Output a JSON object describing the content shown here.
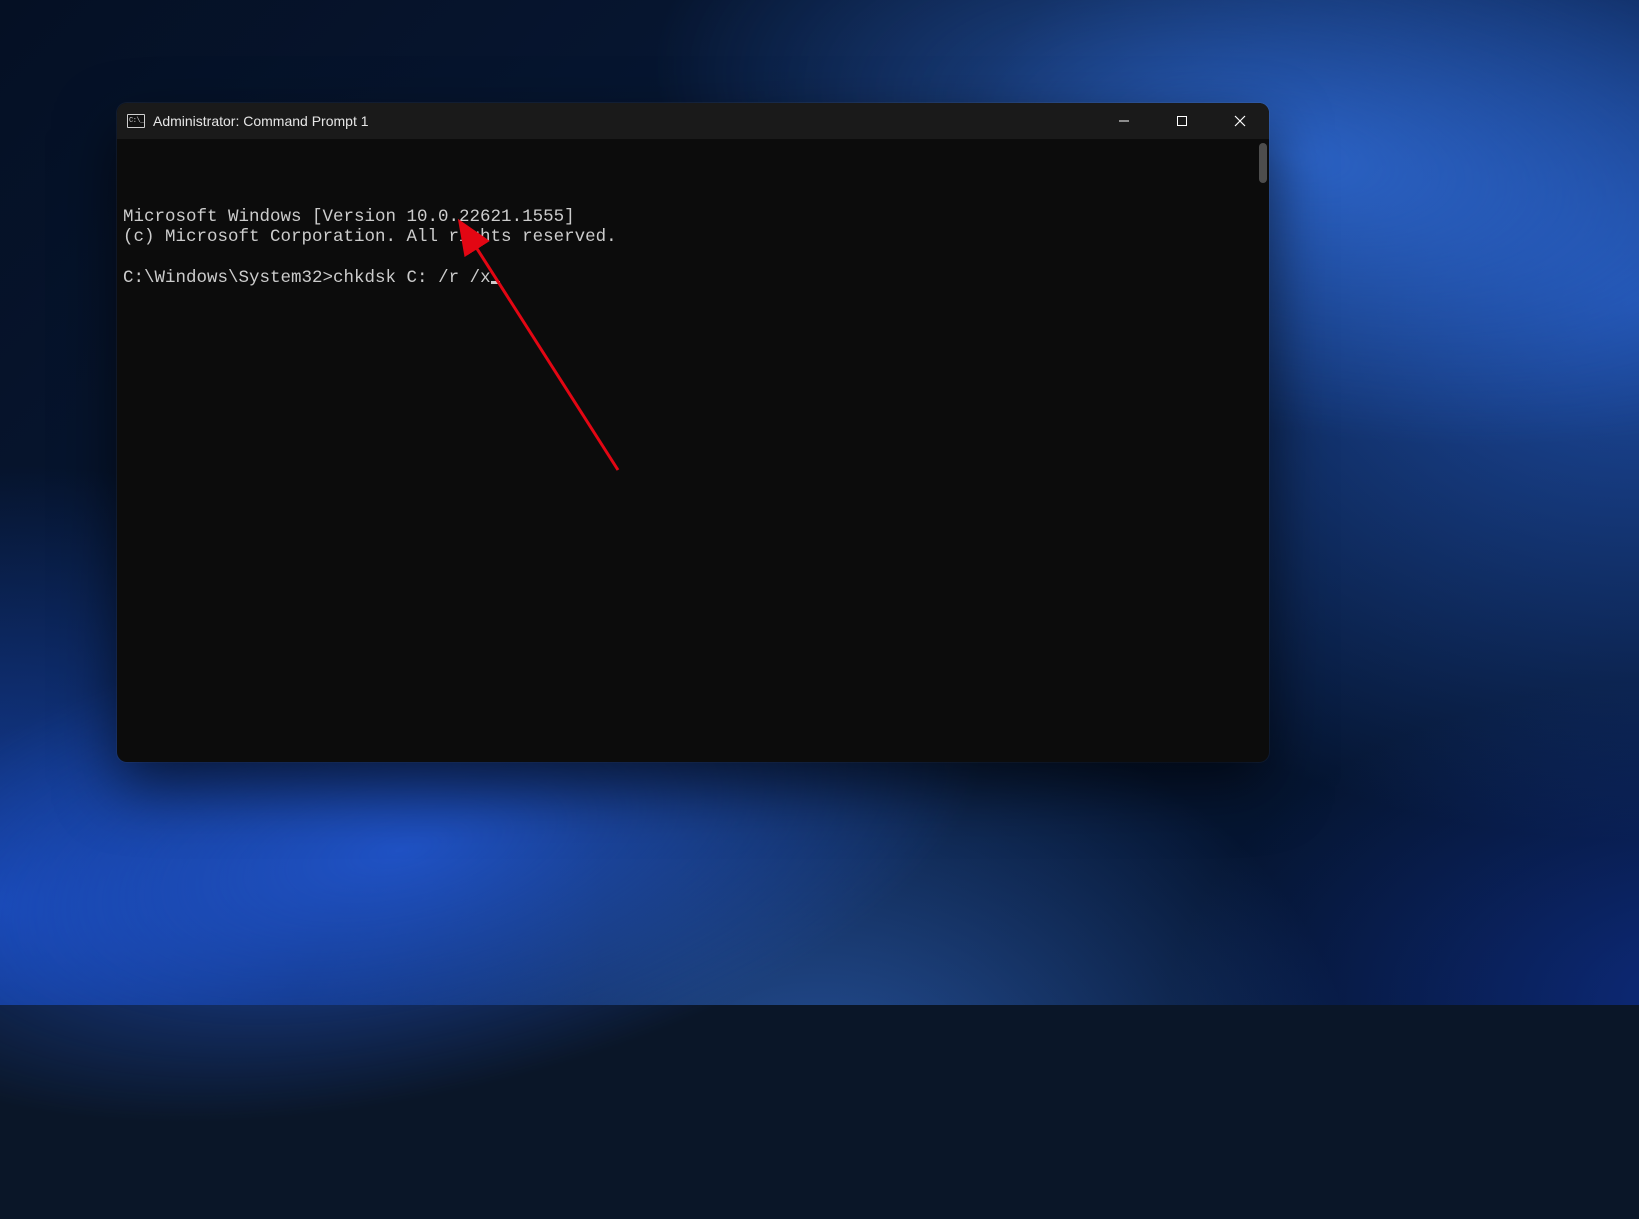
{
  "window": {
    "title": "Administrator: Command Prompt 1"
  },
  "console": {
    "banner_line1": "Microsoft Windows [Version 10.0.22621.1555]",
    "banner_line2": "(c) Microsoft Corporation. All rights reserved.",
    "prompt_path": "C:\\Windows\\System32>",
    "command": "chkdsk C: /r /x"
  },
  "controls": {
    "minimize": "minimize",
    "maximize": "maximize",
    "close": "close"
  },
  "annotation": {
    "color": "#e30613"
  }
}
